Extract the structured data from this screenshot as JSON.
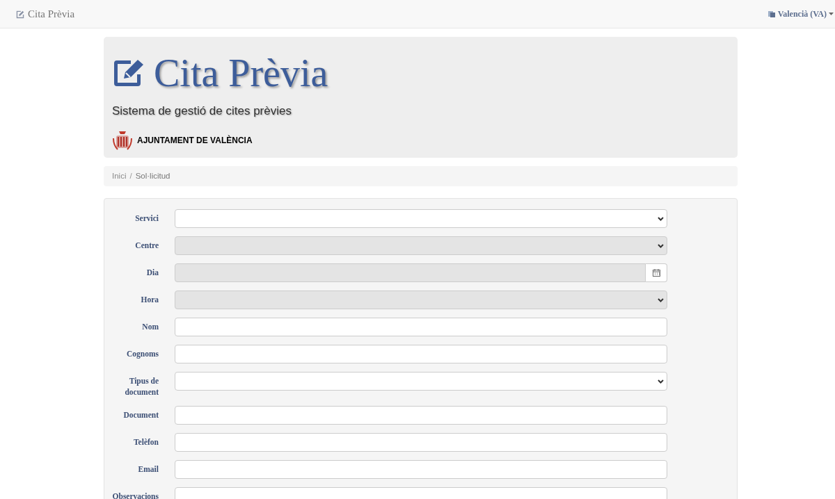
{
  "navbar": {
    "brand": "Cita Prèvia",
    "language": "Valencià (VA)"
  },
  "header": {
    "title": "Cita Prèvia",
    "subtitle": "Sistema de gestió de cites prèvies",
    "organization": "AJUNTAMENT DE VALÈNCIA"
  },
  "breadcrumb_separator": "/",
  "breadcrumb": [
    {
      "label": "Inici",
      "selected": false
    },
    {
      "label": "Sol·licitud",
      "selected": true
    }
  ],
  "form": {
    "fields": [
      {
        "label": "Servici",
        "kind": "select",
        "disabled": false
      },
      {
        "label": "Centre",
        "kind": "select",
        "disabled": true
      },
      {
        "label": "Dia",
        "kind": "date",
        "disabled": true
      },
      {
        "label": "Hora",
        "kind": "select",
        "disabled": true
      },
      {
        "label": "Nom",
        "kind": "text",
        "disabled": false
      },
      {
        "label": "Cognoms",
        "kind": "text",
        "disabled": false
      },
      {
        "label": "Tipus de document",
        "kind": "select",
        "disabled": false
      },
      {
        "label": "Document",
        "kind": "text",
        "disabled": false
      },
      {
        "label": "Telèfon",
        "kind": "text",
        "disabled": false
      },
      {
        "label": "Email",
        "kind": "text",
        "disabled": false
      },
      {
        "label": "Observacions",
        "kind": "text",
        "disabled": false
      }
    ]
  }
}
